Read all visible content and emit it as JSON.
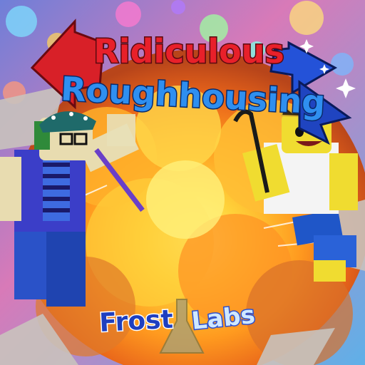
{
  "title": {
    "line1": "Ridiculous",
    "line2": "Roughhousing"
  },
  "studio": {
    "name_part1": "Frost",
    "name_part2": "Labs"
  },
  "colors": {
    "title_red": "#e8202a",
    "title_blue": "#2f8ff0",
    "explosion_core": "#ffe14a",
    "explosion_mid": "#ff9a1f",
    "sky_purple": "#7a5cc8",
    "studio_blue": "#1f3fbf"
  },
  "icons": [
    "left-arrow-icon",
    "right-arrow-icon",
    "crown-icon",
    "crowbar-icon",
    "flask-icon",
    "sparkle-icon"
  ]
}
